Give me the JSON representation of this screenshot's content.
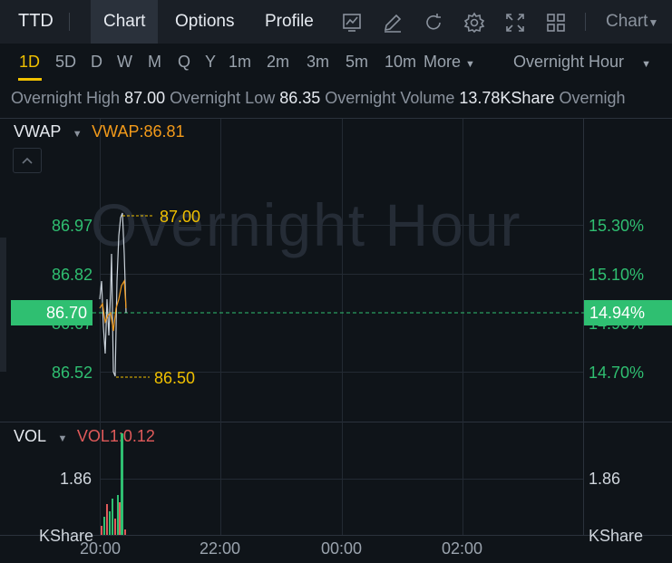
{
  "header": {
    "ticker": "TTD",
    "tabs": [
      {
        "label": "Chart",
        "active": true
      },
      {
        "label": "Options",
        "active": false
      },
      {
        "label": "Profile",
        "active": false
      }
    ],
    "tools": [
      "chart-type-icon",
      "draw-pen-icon",
      "refresh-icon",
      "settings-gear-icon",
      "fullscreen-icon",
      "layout-grid-icon"
    ],
    "chart_menu": "Chart"
  },
  "periods": {
    "items": [
      "1D",
      "5D",
      "D",
      "W",
      "M",
      "Q",
      "Y",
      "1m",
      "2m",
      "3m",
      "5m",
      "10m"
    ],
    "active": "1D",
    "more_label": "More",
    "session": "Overnight Hour"
  },
  "stats": {
    "high_label": "Overnight High",
    "high_value": "87.00",
    "low_label": "Overnight Low",
    "low_value": "86.35",
    "volume_label": "Overnight Volume",
    "volume_value": "13.78KShare",
    "cut_label": "Overnigh"
  },
  "price_pane": {
    "watermark": "Overnight Hour",
    "indicator_name": "VWAP",
    "indicator_value": "VWAP:86.81",
    "left_axis": [
      "86.97",
      "86.82",
      "86.67",
      "86.52"
    ],
    "right_axis": [
      "15.30%",
      "15.10%",
      "14.90%",
      "14.70%"
    ],
    "current_price": "86.70",
    "current_pct": "14.94%",
    "high_marker": "87.00",
    "low_marker": "86.50",
    "colors": {
      "up": "#2fbf71",
      "down": "#e05a5a",
      "vwap": "#f29a1a",
      "price_line": "#c9d1d9",
      "marker": "#f0c000"
    }
  },
  "volume_pane": {
    "indicator_name": "VOL",
    "indicator_value": "VOL1:0.12",
    "left_axis_value": "1.86",
    "left_unit": "KShare",
    "right_axis_value": "1.86",
    "right_unit": "KShare"
  },
  "time_axis": [
    "20:00",
    "22:00",
    "00:00",
    "02:00"
  ]
}
